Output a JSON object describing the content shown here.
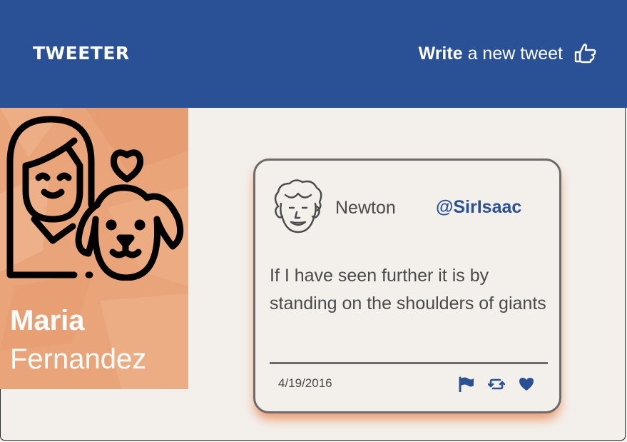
{
  "header": {
    "brand": "TWEETER",
    "write_bold": "Write",
    "write_rest": "a new tweet",
    "write_icon": "pointing-hand-icon"
  },
  "profile": {
    "first_name": "Maria",
    "last_name": "Fernandez",
    "avatar_icon": "woman-with-dog-icon"
  },
  "tweet": {
    "author_name": "Newton",
    "author_handle": "@SirIsaac",
    "text": "If I have seen further it is by standing on the shoulders of giants",
    "date": "4/19/2016",
    "actions": [
      "flag-icon",
      "retweet-icon",
      "heart-icon"
    ]
  },
  "colors": {
    "header_bg": "#2a5195",
    "page_bg": "#f3efea",
    "profile_bg": "#e9a479",
    "accent": "#2a5195",
    "shadow": "#e86c30"
  }
}
